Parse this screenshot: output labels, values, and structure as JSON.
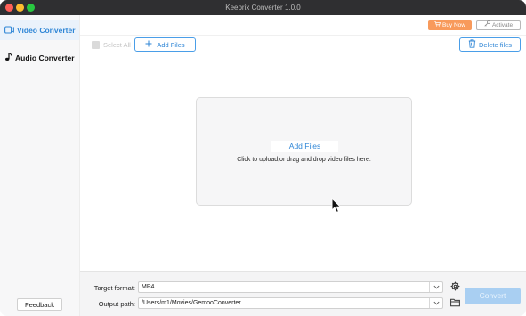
{
  "window": {
    "title": "Keeprix Converter 1.0.0"
  },
  "sidebar": {
    "items": [
      {
        "label": "Video Converter",
        "icon": "video-icon",
        "active": true
      },
      {
        "label": "Audio Converter",
        "icon": "music-note-icon",
        "active": false
      }
    ],
    "feedback_label": "Feedback"
  },
  "topbar": {
    "buy_label": "Buy Now",
    "activate_label": "Activate"
  },
  "toolbar": {
    "select_all_label": "Select All",
    "add_files_label": "Add Files",
    "delete_files_label": "Delete files"
  },
  "dropzone": {
    "title": "Add Files",
    "hint": "Click to upload,or drag and drop video files here."
  },
  "settings": {
    "target_format_label": "Target format:",
    "target_format_value": "MP4",
    "output_path_label": "Output path:",
    "output_path_value": "/Users/m1/Movies/GemooConverter",
    "convert_label": "Convert"
  },
  "colors": {
    "accent": "#2f86d6",
    "buy": "#f89a5b",
    "titlebar": "#2f2f31",
    "convert_disabled": "#a9cff2"
  }
}
